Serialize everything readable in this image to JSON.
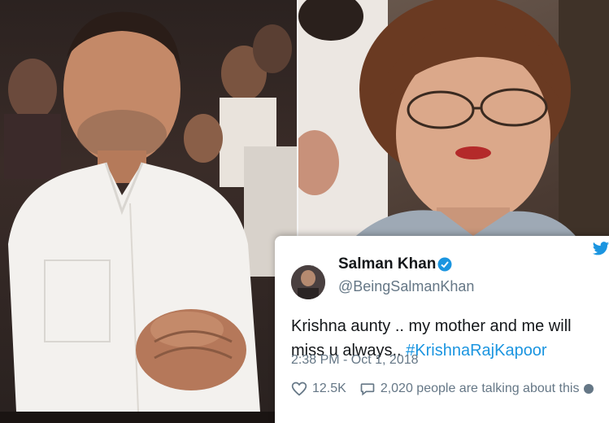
{
  "tweet": {
    "display_name": "Salman Khan",
    "handle": "@BeingSalmanKhan",
    "text_part1": "Krishna aunty .. my mother and me will miss u always..",
    "hashtag": "#KrishnaRajKapoor",
    "timestamp": "2:38 PM - Oct 1, 2018",
    "likes": "12.5K",
    "talking": "2,020 people are talking about this"
  },
  "colors": {
    "accent": "#1b95e0",
    "text": "#14171a",
    "muted": "#657786"
  },
  "icons": [
    "verified-badge-icon",
    "twitter-bird-icon",
    "heart-icon",
    "comment-icon",
    "info-icon"
  ]
}
